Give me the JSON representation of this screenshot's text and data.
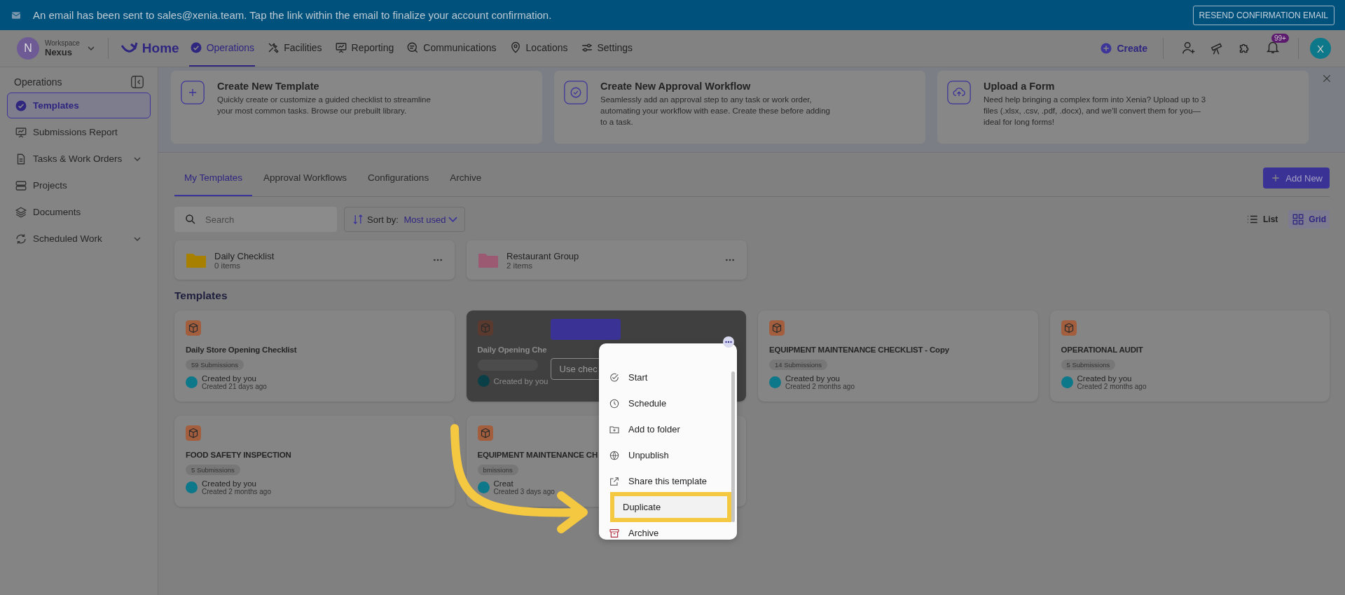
{
  "banner": {
    "message": "An email has been sent to sales@xenia.team. Tap the link within the email to finalize your account confirmation.",
    "button": "RESEND CONFIRMATION EMAIL"
  },
  "workspace": {
    "initial": "N",
    "caption": "Workspace",
    "name": "Nexus"
  },
  "nav": {
    "home": "Home",
    "items": [
      {
        "label": "Operations",
        "selected": true
      },
      {
        "label": "Facilities",
        "selected": false
      },
      {
        "label": "Reporting",
        "selected": false
      },
      {
        "label": "Communications",
        "selected": false
      },
      {
        "label": "Locations",
        "selected": false
      },
      {
        "label": "Settings",
        "selected": false
      }
    ],
    "create": "Create",
    "notifications": "99+",
    "avatar": "X"
  },
  "sidebar": {
    "title": "Operations",
    "items": [
      {
        "label": "Templates",
        "selected": true,
        "expandable": false
      },
      {
        "label": "Submissions Report",
        "selected": false,
        "expandable": false
      },
      {
        "label": "Tasks & Work Orders",
        "selected": false,
        "expandable": true
      },
      {
        "label": "Projects",
        "selected": false,
        "expandable": false
      },
      {
        "label": "Documents",
        "selected": false,
        "expandable": false
      },
      {
        "label": "Scheduled Work",
        "selected": false,
        "expandable": true
      }
    ]
  },
  "promo_cards": [
    {
      "title": "Create New Template",
      "text": "Quickly create or customize a guided checklist to streamline your most common tasks. Browse our prebuilt library."
    },
    {
      "title": "Create New Approval Workflow",
      "text": "Seamlessly add an approval step to any task or work order, automating your workflow with ease. Create these before adding to a task."
    },
    {
      "title": "Upload a Form",
      "text": "Need help bringing a complex form into Xenia? Upload up to 3 files (.xlsx, .csv, .pdf, .docx), and we'll convert them for you—ideal for long forms!"
    }
  ],
  "tabs": [
    {
      "label": "My Templates",
      "selected": true
    },
    {
      "label": "Approval Workflows",
      "selected": false
    },
    {
      "label": "Configurations",
      "selected": false
    },
    {
      "label": "Archive",
      "selected": false
    }
  ],
  "add_new": "Add New",
  "search": {
    "placeholder": "Search"
  },
  "sort": {
    "label": "Sort by:",
    "value": "Most used"
  },
  "views": [
    {
      "label": "List",
      "selected": false
    },
    {
      "label": "Grid",
      "selected": true
    }
  ],
  "folders": [
    {
      "name": "Daily Checklist",
      "count": "0 items",
      "color": "#a88000"
    },
    {
      "name": "Restaurant Group",
      "count": "2 items",
      "color": "#9c5a72"
    }
  ],
  "templates_heading": "Templates",
  "templates": [
    {
      "title": "Daily Store Opening Checklist",
      "submissions": "59 Submissions",
      "creator": "Created by you",
      "created": "Created 21 days ago",
      "hovered": false
    },
    {
      "title": "Daily Opening Che",
      "creator": "Created by you",
      "button": "Use chec",
      "hovered": true
    },
    {
      "title": "EQUIPMENT MAINTENANCE CHECKLIST - Copy",
      "submissions": "14 Submissions",
      "creator": "Created by you",
      "created": "Created 2 months ago",
      "hovered": false
    },
    {
      "title": "OPERATIONAL AUDIT",
      "submissions": "5 Submissions",
      "creator": "Created by you",
      "created": "Created 2 months ago",
      "hovered": false
    },
    {
      "title": "FOOD SAFETY INSPECTION",
      "submissions": "5 Submissions",
      "creator": "Created by you",
      "created": "Created 2 months ago",
      "hovered": false
    },
    {
      "title": "EQUIPMENT MAINTENANCE CH",
      "submissions": "bmissions",
      "creator": "Creat",
      "created": "Created 3 days ago",
      "hovered": false
    }
  ],
  "context_menu": {
    "items": [
      {
        "label": "Start",
        "highlighted": false
      },
      {
        "label": "Schedule",
        "highlighted": false
      },
      {
        "label": "Add to folder",
        "highlighted": false
      },
      {
        "label": "Unpublish",
        "highlighted": false
      },
      {
        "label": "Share this template",
        "highlighted": false
      },
      {
        "label": "Duplicate",
        "highlighted": true
      },
      {
        "label": "Archive",
        "highlighted": false
      }
    ]
  }
}
